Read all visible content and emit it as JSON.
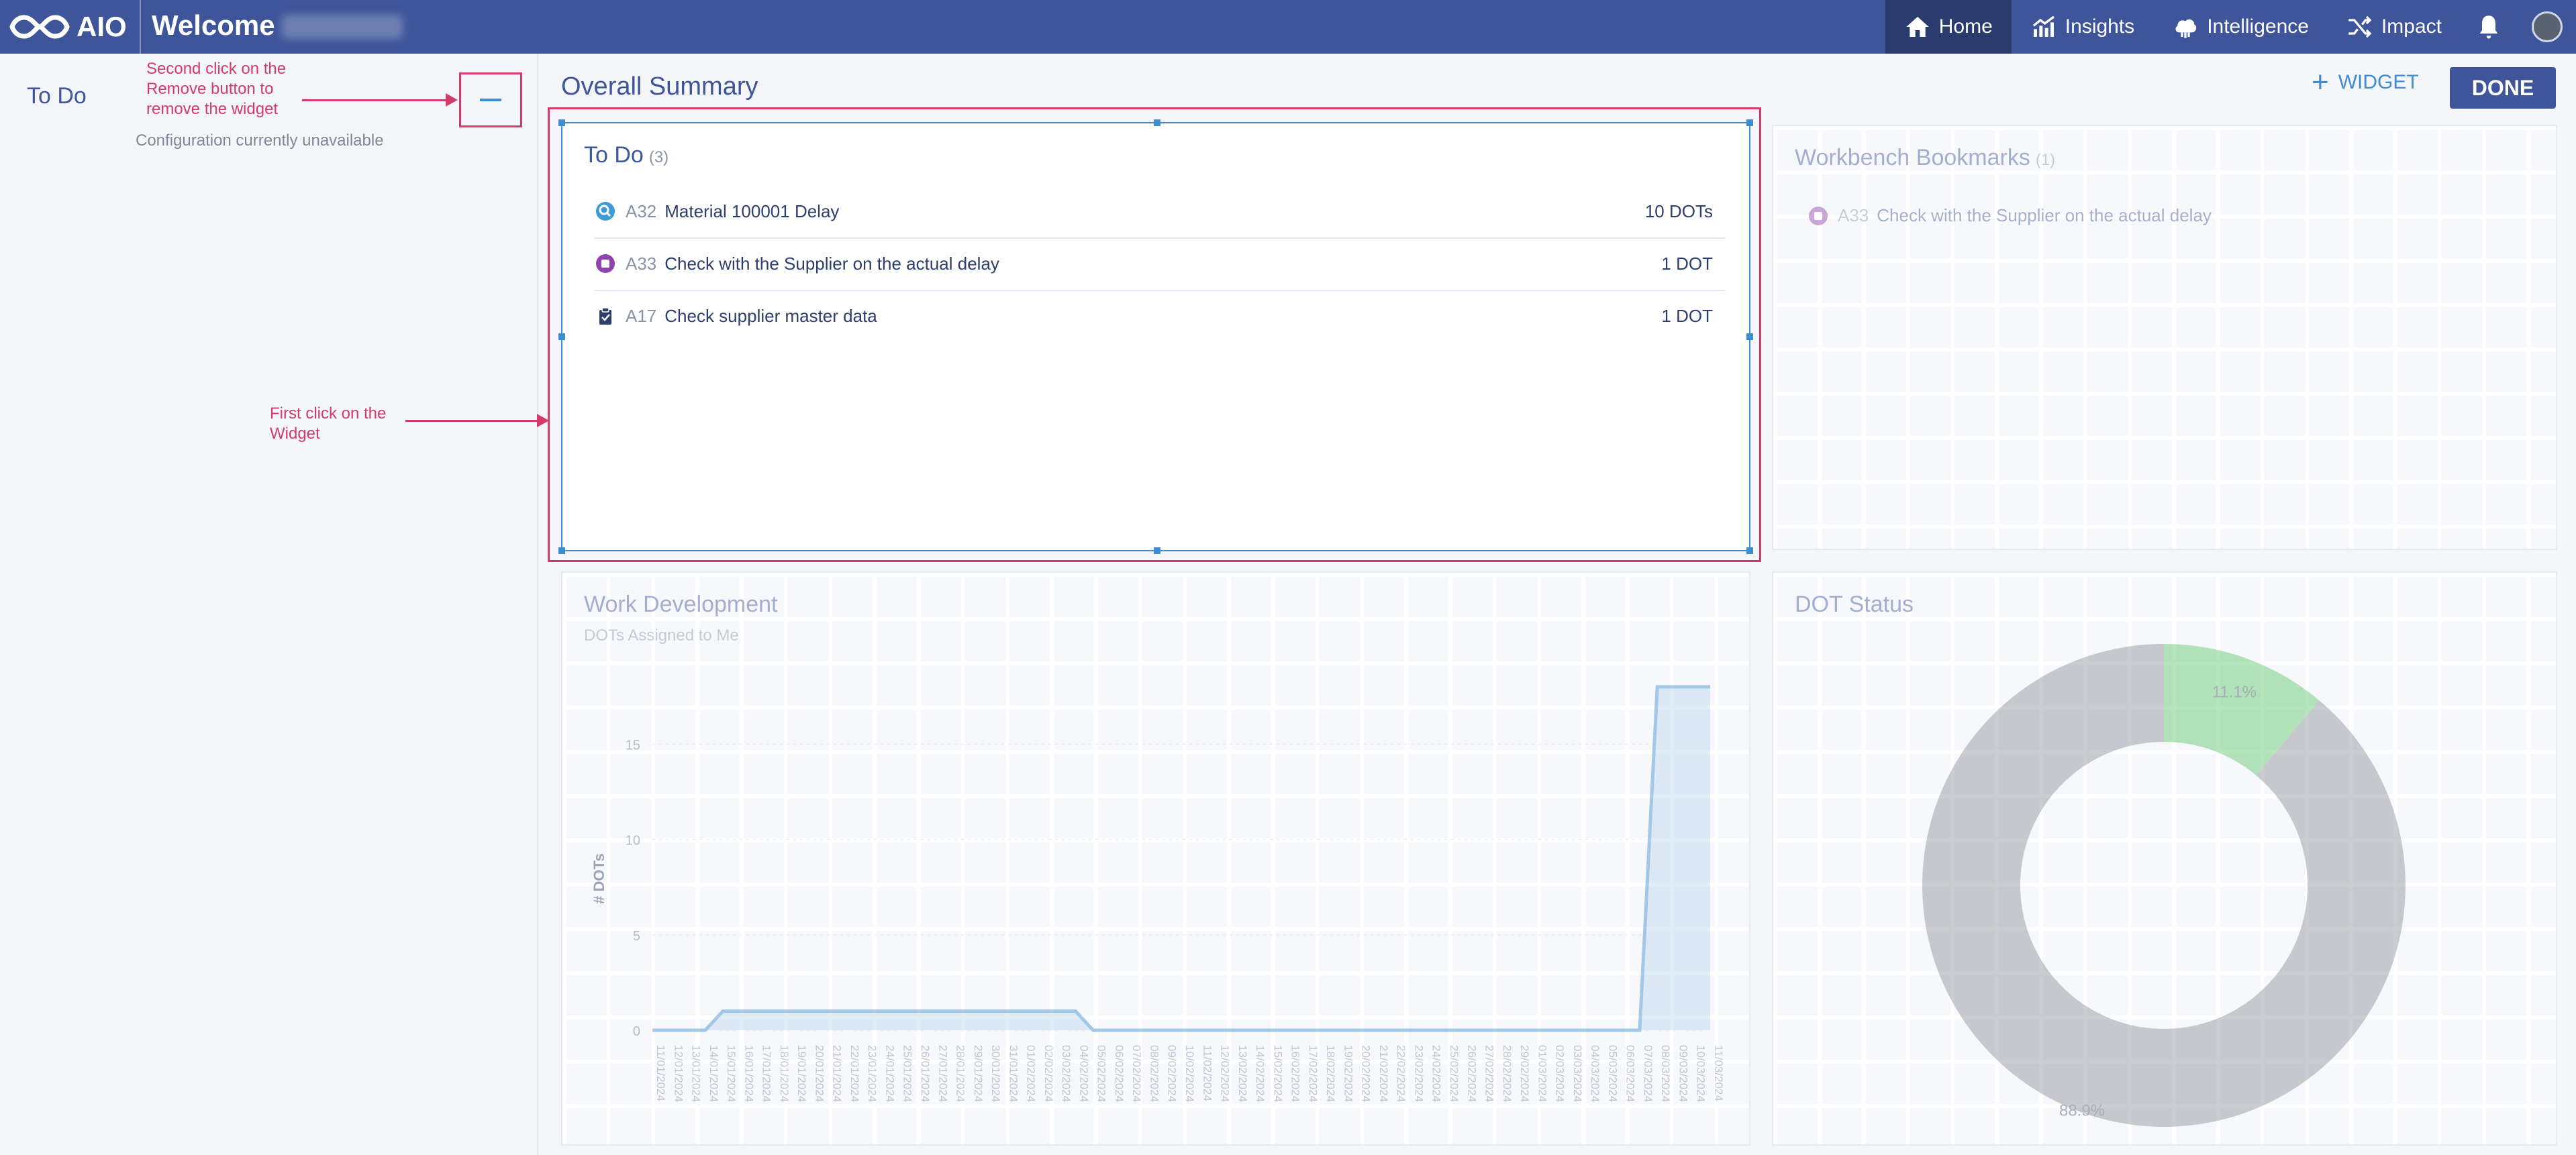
{
  "header": {
    "brand": "AIO",
    "welcome": "Welcome",
    "nav": [
      {
        "label": "Home",
        "icon": "home-icon",
        "active": true
      },
      {
        "label": "Insights",
        "icon": "chart-icon"
      },
      {
        "label": "Intelligence",
        "icon": "brain-cloud-icon"
      },
      {
        "label": "Impact",
        "icon": "shuffle-icon"
      }
    ]
  },
  "sidebar": {
    "title": "To Do",
    "note": "Configuration currently unavailable"
  },
  "annotations": {
    "remove": "Second click on the\nRemove button to\nremove the widget",
    "widget": "First click on the\nWidget"
  },
  "main": {
    "title": "Overall Summary",
    "widget_button": "WIDGET",
    "done_button": "DONE"
  },
  "todo": {
    "title": "To Do",
    "count": "(3)",
    "items": [
      {
        "id": "A32",
        "name": "Material 100001 Delay",
        "count": "10 DOTs",
        "icon": "magnifier-badge-icon"
      },
      {
        "id": "A33",
        "name": "Check with the Supplier on the actual delay",
        "count": "1 DOT",
        "icon": "bookmark-badge-icon"
      },
      {
        "id": "A17",
        "name": "Check supplier master data",
        "count": "1 DOT",
        "icon": "clipboard-icon"
      }
    ]
  },
  "bookmarks": {
    "title": "Workbench Bookmarks",
    "count": "(1)",
    "items": [
      {
        "id": "A33",
        "name": "Check with the Supplier on the actual delay"
      }
    ]
  },
  "chart_data": [
    {
      "type": "area",
      "title": "Work Development",
      "subtitle": "DOTs Assigned to Me",
      "ylabel": "# DOTs",
      "ylim": [
        0,
        18
      ],
      "yticks": [
        0,
        5,
        10,
        15
      ],
      "x": [
        "11/01/2024",
        "12/01/2024",
        "13/01/2024",
        "14/01/2024",
        "15/01/2024",
        "16/01/2024",
        "17/01/2024",
        "18/01/2024",
        "19/01/2024",
        "20/01/2024",
        "21/01/2024",
        "22/01/2024",
        "23/01/2024",
        "24/01/2024",
        "25/01/2024",
        "26/01/2024",
        "27/01/2024",
        "28/01/2024",
        "29/01/2024",
        "30/01/2024",
        "31/01/2024",
        "01/02/2024",
        "02/02/2024",
        "03/02/2024",
        "04/02/2024",
        "05/02/2024",
        "06/02/2024",
        "07/02/2024",
        "08/02/2024",
        "09/02/2024",
        "10/02/2024",
        "11/02/2024",
        "12/02/2024",
        "13/02/2024",
        "14/02/2024",
        "15/02/2024",
        "16/02/2024",
        "17/02/2024",
        "18/02/2024",
        "19/02/2024",
        "20/02/2024",
        "21/02/2024",
        "22/02/2024",
        "23/02/2024",
        "24/02/2024",
        "25/02/2024",
        "26/02/2024",
        "27/02/2024",
        "28/02/2024",
        "29/02/2024",
        "01/03/2024",
        "02/03/2024",
        "03/03/2024",
        "04/03/2024",
        "05/03/2024",
        "06/03/2024",
        "07/03/2024",
        "08/03/2024",
        "09/03/2024",
        "10/03/2024",
        "11/03/2024"
      ],
      "series": [
        {
          "values": [
            0,
            0,
            0,
            0,
            1,
            1,
            1,
            1,
            1,
            1,
            1,
            1,
            1,
            1,
            1,
            1,
            1,
            1,
            1,
            1,
            1,
            1,
            1,
            1,
            1,
            0,
            0,
            0,
            0,
            0,
            0,
            0,
            0,
            0,
            0,
            0,
            0,
            0,
            0,
            0,
            0,
            0,
            0,
            0,
            0,
            0,
            0,
            0,
            0,
            0,
            0,
            0,
            0,
            0,
            0,
            0,
            0,
            18,
            18,
            18,
            18
          ]
        }
      ],
      "color": "#3f8ccf"
    },
    {
      "type": "pie",
      "title": "DOT Status",
      "donut": true,
      "slices": [
        {
          "value": 11.1,
          "label": "11.1%",
          "color": "#5cc66b"
        },
        {
          "value": 88.9,
          "label": "88.9%",
          "color": "#8e9099"
        }
      ]
    }
  ]
}
